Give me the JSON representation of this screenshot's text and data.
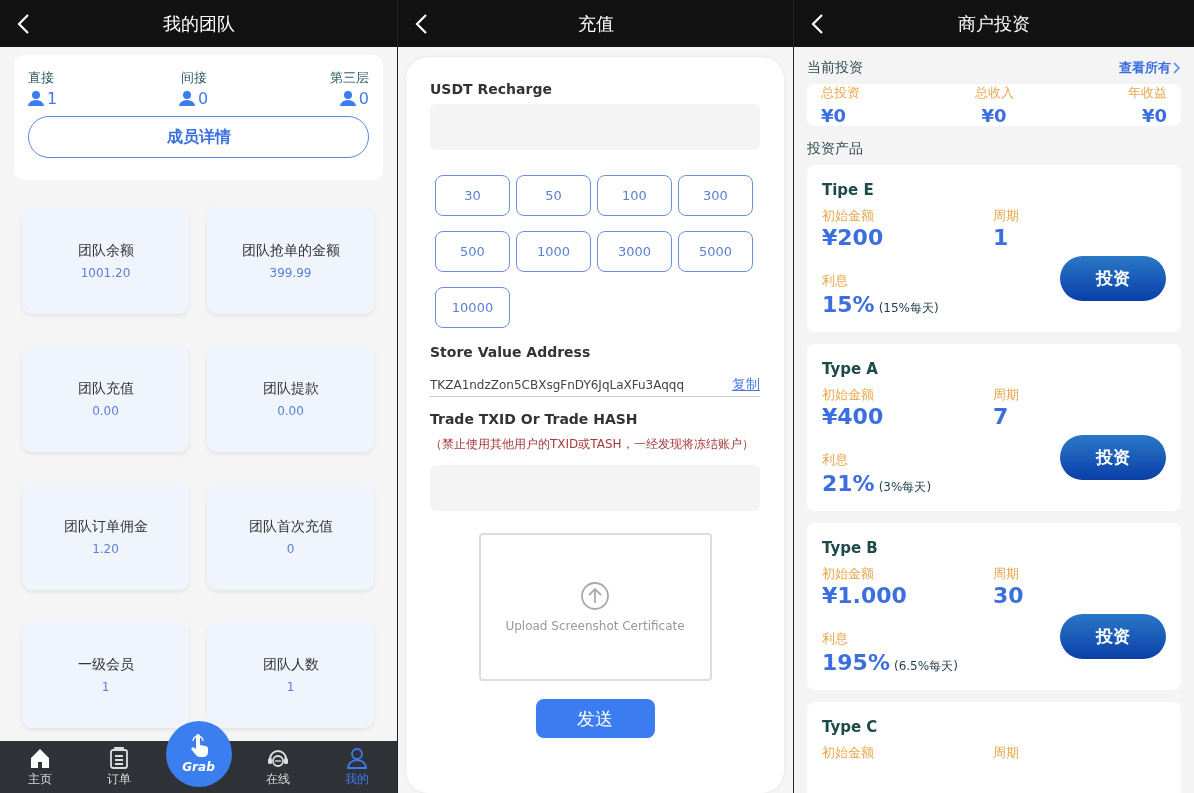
{
  "team": {
    "title": "我的团队",
    "levels": [
      {
        "label": "直接",
        "count": "1"
      },
      {
        "label": "间接",
        "count": "0"
      },
      {
        "label": "第三层",
        "count": "0"
      }
    ],
    "detail_button": "成员详情",
    "stats": [
      {
        "label": "团队余额",
        "value": "1001.20"
      },
      {
        "label": "团队抢单的金额",
        "value": "399.99"
      },
      {
        "label": "团队充值",
        "value": "0.00"
      },
      {
        "label": "团队提款",
        "value": "0.00"
      },
      {
        "label": "团队订单佣金",
        "value": "1.20"
      },
      {
        "label": "团队首次充值",
        "value": "0"
      },
      {
        "label": "一级会员",
        "value": "1"
      },
      {
        "label": "团队人数",
        "value": "1"
      }
    ],
    "nav": [
      {
        "kind": "home",
        "label": "主页",
        "selected": false
      },
      {
        "kind": "orders",
        "label": "订单",
        "selected": false
      },
      {
        "kind": "grab",
        "label": "Grab",
        "selected": false
      },
      {
        "kind": "online",
        "label": "在线",
        "selected": false
      },
      {
        "kind": "profile",
        "label": "我的",
        "selected": true
      }
    ]
  },
  "recharge": {
    "title": "充值",
    "amount_label": "USDT Recharge",
    "amounts": [
      "30",
      "50",
      "100",
      "300",
      "500",
      "1000",
      "3000",
      "5000",
      "10000"
    ],
    "address_label": "Store Value Address",
    "address": "TKZA1ndzZon5CBXsgFnDY6JqLaXFu3Aqqq",
    "copy_link": "复制",
    "txid_label": "Trade TXID Or Trade HASH",
    "warning": "（禁止使用其他用户的TXID或TASH，一经发现将冻结账户）",
    "upload_text": "Upload Screenshot Certificate",
    "submit": "发送"
  },
  "invest": {
    "title": "商户投资",
    "current_label": "当前投资",
    "view_all": "查看所有",
    "summary": [
      {
        "label": "总投资",
        "value": "¥0"
      },
      {
        "label": "总收入",
        "value": "¥0"
      },
      {
        "label": "年收益",
        "value": "¥0"
      }
    ],
    "products_label": "投资产品",
    "products": [
      {
        "name": "Tipe E",
        "amount_label": "初始金额",
        "amount": "¥200",
        "period_label": "周期",
        "period": "1",
        "interest_label": "利息",
        "interest": "15%",
        "daily": "(15%每天)",
        "button": "投资"
      },
      {
        "name": "Type A",
        "amount_label": "初始金额",
        "amount": "¥400",
        "period_label": "周期",
        "period": "7",
        "interest_label": "利息",
        "interest": "21%",
        "daily": "(3%每天)",
        "button": "投资"
      },
      {
        "name": "Type B",
        "amount_label": "初始金额",
        "amount": "¥1.000",
        "period_label": "周期",
        "period": "30",
        "interest_label": "利息",
        "interest": "195%",
        "daily": "(6.5%每天)",
        "button": "投资"
      },
      {
        "name": "Type C",
        "amount_label": "初始金额",
        "period_label": "周期"
      }
    ]
  }
}
